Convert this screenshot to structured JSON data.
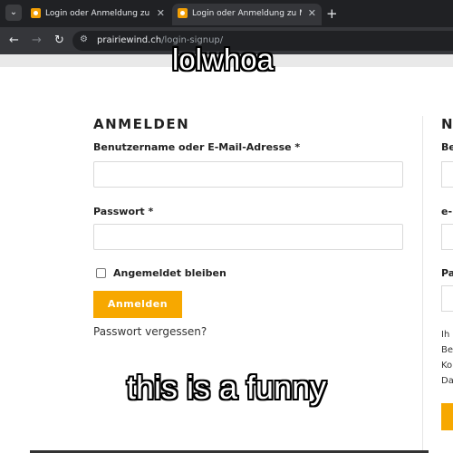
{
  "browser": {
    "tabs": [
      {
        "title": "Login oder Anmeldung zu Mein",
        "active": false
      },
      {
        "title": "Login oder Anmeldung zu Mein",
        "active": true
      }
    ],
    "url_host": "prairiewind.ch",
    "url_path": "/login-signup/"
  },
  "login": {
    "heading": "ANMELDEN",
    "username_label": "Benutzername oder E-Mail-Adresse *",
    "username_value": "",
    "password_label": "Passwort *",
    "password_value": "",
    "remember_label": "Angemeldet bleiben",
    "remember_checked": false,
    "submit_label": "Anmelden",
    "forgot_link": "Passwort vergessen?"
  },
  "register": {
    "heading_fragment": "N",
    "label1_fragment": "Be",
    "label2_fragment": "e-",
    "label3_fragment": "Pa",
    "text_fragments": [
      "Ih",
      "Be",
      "Ko",
      "Da"
    ]
  },
  "captions": {
    "top": "lolwhoa",
    "bottom": "this is a funny"
  },
  "colors": {
    "accent": "#f7a800",
    "chrome_dark": "#202124",
    "chrome_mid": "#35363a"
  }
}
